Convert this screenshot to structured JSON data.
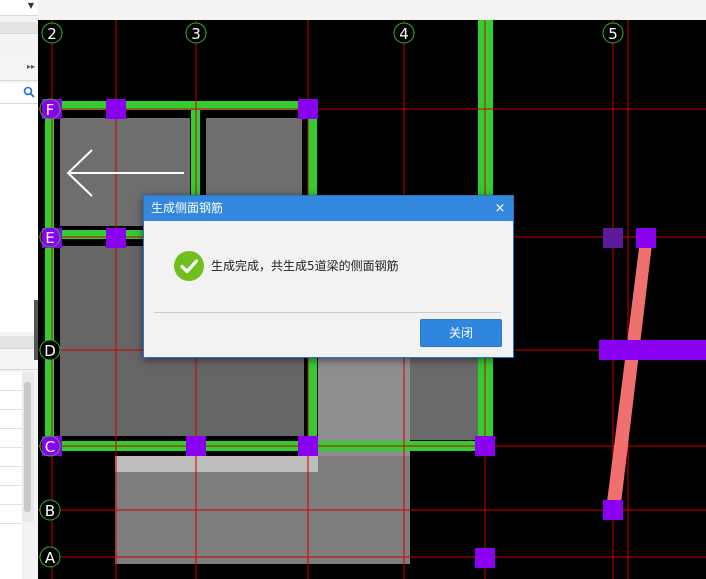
{
  "search": {
    "icon": "search-icon"
  },
  "grid": {
    "axis_labels_top": [
      "2",
      "3",
      "4",
      "5"
    ],
    "axis_labels_left": [
      "F",
      "E",
      "D",
      "C",
      "B",
      "A"
    ]
  },
  "dialog": {
    "title": "生成侧面钢筋",
    "close_glyph": "×",
    "message": "生成完成，共生成5道梁的侧面钢筋",
    "button_label": "关闭"
  },
  "colors": {
    "grid_line": "#d00000",
    "beam": "#33cc33",
    "column": "#8a00f0",
    "slab": "#6e6e6e",
    "dialog_title_bg": "#3388de",
    "button_bg": "#2f86de",
    "success_icon": "#6fbf1f",
    "diagonal_beam": "#f07070"
  }
}
